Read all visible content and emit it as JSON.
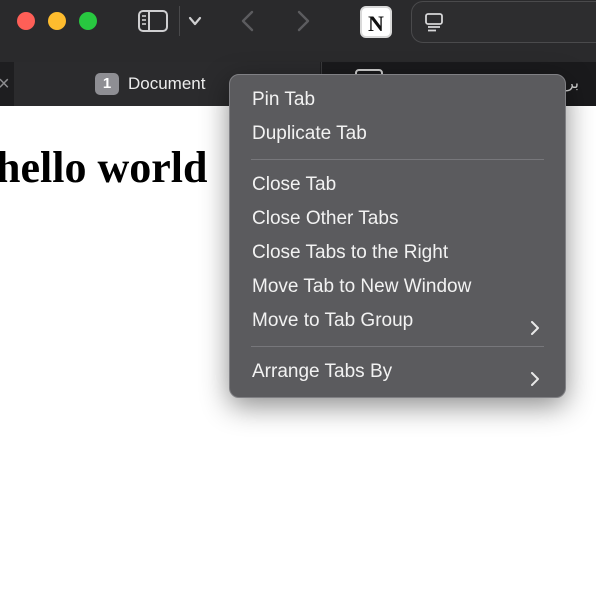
{
  "toolbar": {
    "window_controls": [
      "close",
      "minimize",
      "zoom"
    ],
    "icons": [
      "sidebar-icon",
      "chevron-down-icon",
      "back-arrow-icon",
      "forward-arrow-icon",
      "notion-icon",
      "page-icon"
    ],
    "notion_letter": "N"
  },
  "tabs": [
    {
      "number": "1",
      "title": "Document",
      "active": true
    },
    {
      "title": "برنامج",
      "active": false
    }
  ],
  "page": {
    "heading": "hello world"
  },
  "context_menu": {
    "group1": [
      {
        "label": "Pin Tab"
      },
      {
        "label": "Duplicate Tab"
      }
    ],
    "group2": [
      {
        "label": "Close Tab"
      },
      {
        "label": "Close Other Tabs"
      },
      {
        "label": "Close Tabs to the Right"
      },
      {
        "label": "Move Tab to New Window"
      },
      {
        "label": "Move to Tab Group",
        "submenu": true
      }
    ],
    "group3": [
      {
        "label": "Arrange Tabs By",
        "submenu": true
      }
    ]
  },
  "colors": {
    "toolbar_bg": "#2a2a2c",
    "tabbar_bg": "#1e1e20",
    "menu_bg": "#5b5b5e",
    "close": "#fe5f57",
    "minimize": "#febc2e",
    "zoom": "#28c840"
  }
}
